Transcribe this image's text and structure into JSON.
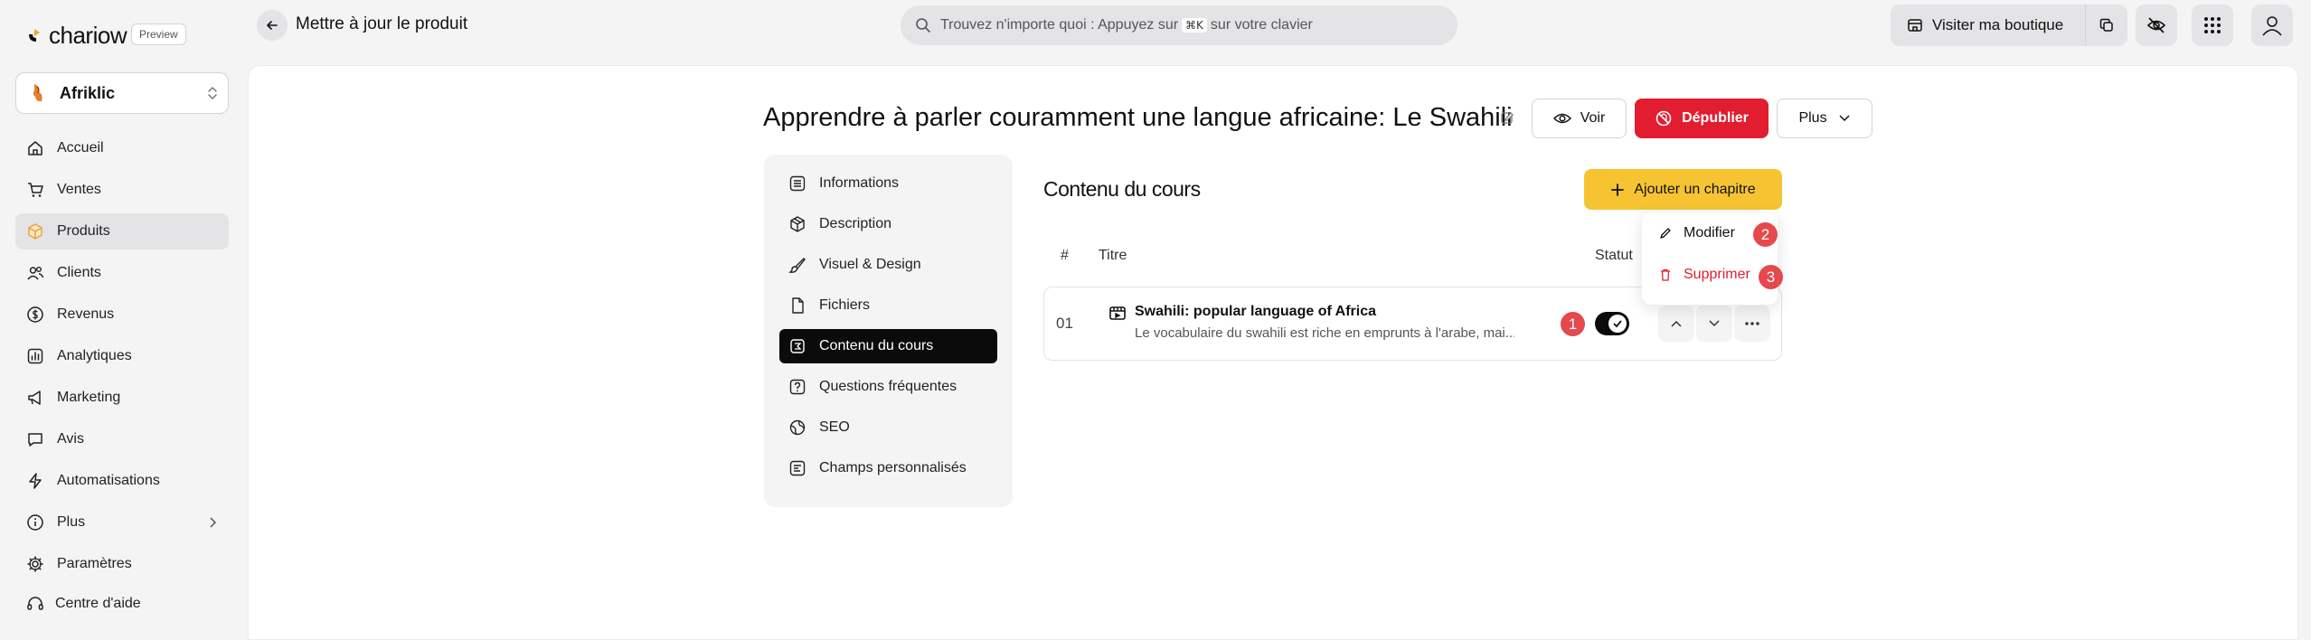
{
  "brand": {
    "name": "chariow",
    "preview": "Preview"
  },
  "header": {
    "title": "Mettre à jour le produit",
    "search_pre": "Trouvez n'importe quoi : Appuyez sur",
    "search_key": "⌘K",
    "search_post": "sur votre clavier",
    "visit_label": "Visiter ma boutique"
  },
  "sidebar": {
    "store": "Afriklic",
    "items": [
      {
        "label": "Accueil",
        "icon": "home-icon"
      },
      {
        "label": "Ventes",
        "icon": "cart-icon"
      },
      {
        "label": "Produits",
        "icon": "box-icon",
        "active": true
      },
      {
        "label": "Clients",
        "icon": "users-icon"
      },
      {
        "label": "Revenus",
        "icon": "dollar-icon"
      },
      {
        "label": "Analytiques",
        "icon": "chart-icon"
      },
      {
        "label": "Marketing",
        "icon": "megaphone-icon"
      },
      {
        "label": "Avis",
        "icon": "chat-icon"
      },
      {
        "label": "Automatisations",
        "icon": "bolt-icon"
      },
      {
        "label": "Plus",
        "icon": "info-icon"
      },
      {
        "label": "Paramètres",
        "icon": "gear-icon"
      }
    ],
    "help": "Centre d'aide"
  },
  "product": {
    "title": "Apprendre à parler couramment une langue africaine: Le Swahili",
    "view_label": "Voir",
    "unpublish_label": "Dépublier",
    "more_label": "Plus"
  },
  "tabs": [
    {
      "label": "Informations",
      "icon": "list-icon"
    },
    {
      "label": "Description",
      "icon": "package-icon"
    },
    {
      "label": "Visuel & Design",
      "icon": "brush-icon"
    },
    {
      "label": "Fichiers",
      "icon": "file-icon"
    },
    {
      "label": "Contenu du cours",
      "icon": "course-icon",
      "active": true
    },
    {
      "label": "Questions fréquentes",
      "icon": "question-icon"
    },
    {
      "label": "SEO",
      "icon": "globe-icon"
    },
    {
      "label": "Champs personnalisés",
      "icon": "fields-icon"
    }
  ],
  "content": {
    "section_title": "Contenu du cours",
    "add_chapter_label": "Ajouter un chapitre",
    "columns": {
      "num": "#",
      "title": "Titre",
      "status": "Statut"
    },
    "rows": [
      {
        "num": "01",
        "title": "Swahili: popular language of Africa",
        "desc": "Le vocabulaire du swahili est riche en emprunts à l'arabe, mai..."
      }
    ]
  },
  "context_menu": {
    "edit": "Modifier",
    "delete": "Supprimer"
  },
  "badges": [
    "1",
    "2",
    "3"
  ],
  "colors": {
    "danger": "#e11d2f",
    "accent": "#f6c432",
    "badge": "#e5484d",
    "dark": "#0b0b0b"
  }
}
